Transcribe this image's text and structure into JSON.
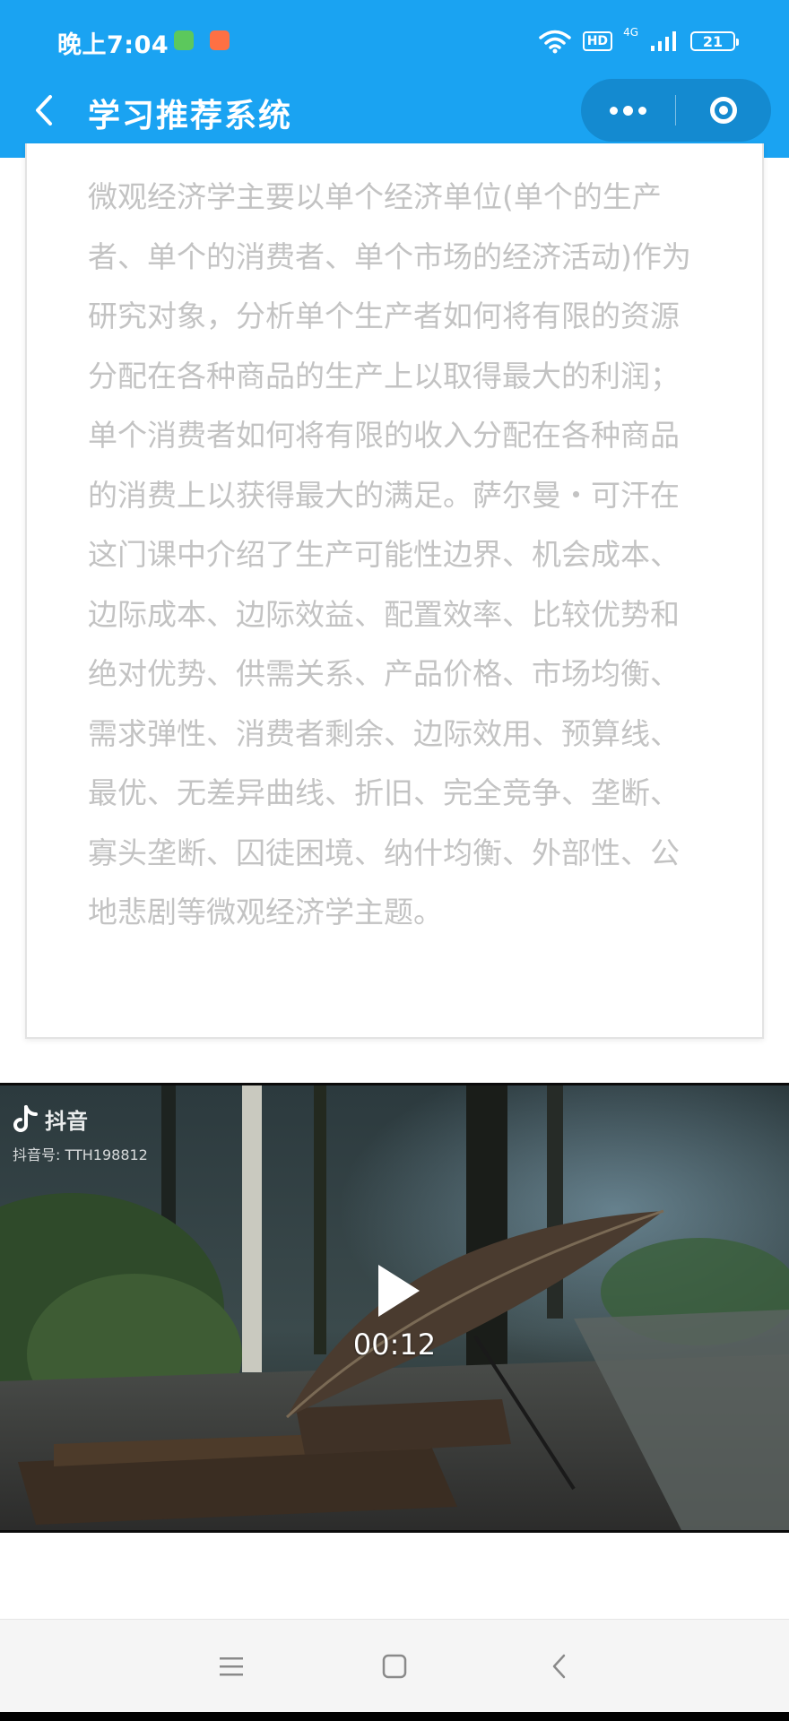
{
  "status_bar": {
    "time": "晚上7:04",
    "hd_label": "HD",
    "network_label": "4G",
    "battery_level": "21"
  },
  "nav": {
    "title": "学习推荐系统"
  },
  "course": {
    "description": "微观经济学主要以单个经济单位(单个的生产者、单个的消费者、单个市场的经济活动)作为研究对象，分析单个生产者如何将有限的资源分配在各种商品的生产上以取得最大的利润；单个消费者如何将有限的收入分配在各种商品的消费上以获得最大的满足。萨尔曼・可汗在这门课中介绍了生产可能性边界、机会成本、边际成本、边际效益、配置效率、比较优势和绝对优势、供需关系、产品价格、市场均衡、需求弹性、消费者剩余、边际效用、预算线、最优、无差异曲线、折旧、完全竞争、垄断、寡头垄断、囚徒困境、纳什均衡、外部性、公地悲剧等微观经济学主题。"
  },
  "video": {
    "watermark_brand": "抖音",
    "watermark_id": "抖音号: TTH198812",
    "duration": "00:12"
  },
  "colors": {
    "header_bg": "#1aa3f2",
    "capsule_bg": "#148ad0",
    "description_text": "#c3c3c3"
  },
  "icons": {
    "back": "chevron-left-icon",
    "more": "more-dots-icon",
    "close": "target-circle-icon",
    "play": "play-icon",
    "menu": "menu-lines-icon",
    "home": "square-home-icon",
    "system_back": "chevron-left-icon"
  }
}
